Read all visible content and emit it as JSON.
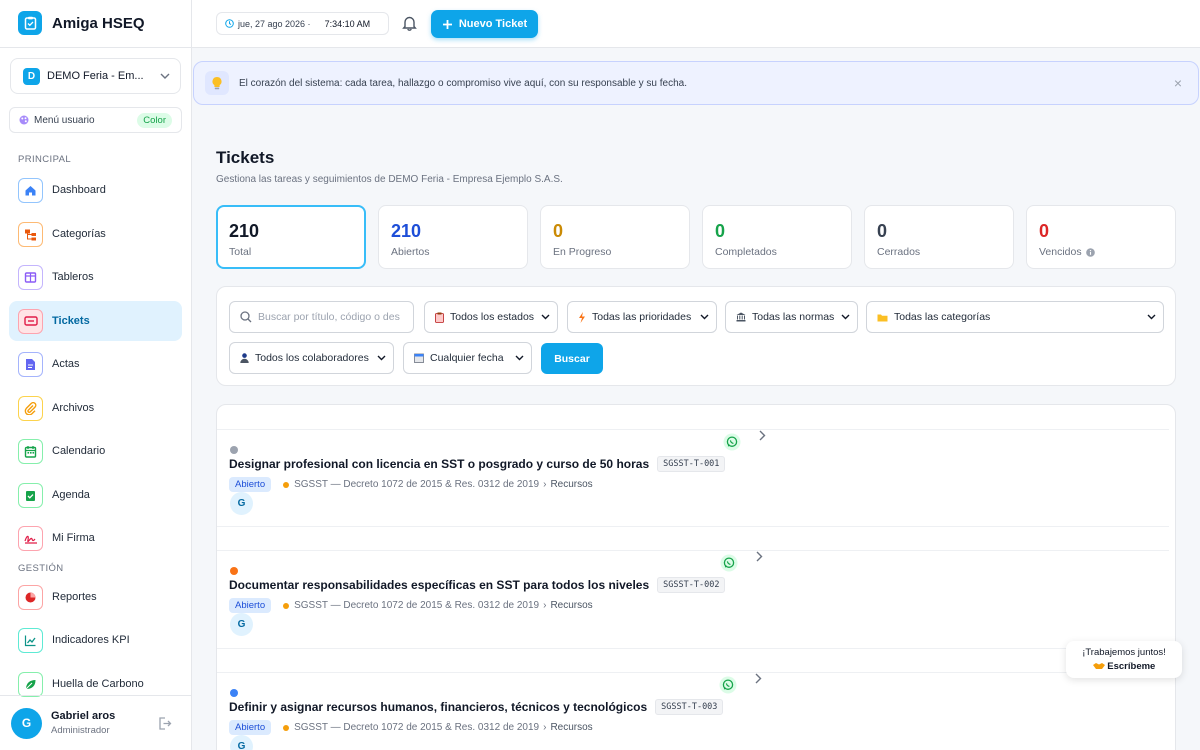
{
  "app": {
    "name": "Amiga HSEQ"
  },
  "org": {
    "badge": "D",
    "name": "DEMO Feria - Em..."
  },
  "user_menu": {
    "label": "Menú usuario",
    "badge": "Color"
  },
  "sections": {
    "principal": "PRINCIPAL",
    "gestion": "GESTIÓN"
  },
  "nav": [
    {
      "label": "Dashboard",
      "icon": "home-icon",
      "color": "#3b82f6"
    },
    {
      "label": "Categorías",
      "icon": "hierarchy-icon",
      "color": "#ea580c"
    },
    {
      "label": "Tableros",
      "icon": "board-icon",
      "color": "#8b5cf6"
    },
    {
      "label": "Tickets",
      "icon": "ticket-icon",
      "color": "#e11d48"
    },
    {
      "label": "Actas",
      "icon": "document-icon",
      "color": "#6366f1"
    },
    {
      "label": "Archivos",
      "icon": "paperclip-icon",
      "color": "#f59e0b"
    },
    {
      "label": "Calendario",
      "icon": "calendar-icon",
      "color": "#16a34a"
    },
    {
      "label": "Agenda",
      "icon": "checklist-icon",
      "color": "#16a34a"
    },
    {
      "label": "Mi Firma",
      "icon": "signature-icon",
      "color": "#e11d48"
    },
    {
      "label": "Reportes",
      "icon": "pie-chart-icon",
      "color": "#dc2626"
    },
    {
      "label": "Indicadores KPI",
      "icon": "line-chart-icon",
      "color": "#0d9488"
    },
    {
      "label": "Huella de Carbono",
      "icon": "leaf-icon",
      "color": "#16a34a"
    }
  ],
  "user": {
    "initial": "G",
    "name": "Gabriel aros",
    "role": "Administrador"
  },
  "topbar": {
    "date": "jue, 27 ago 2026 ·",
    "time": "7:34:10 AM",
    "new_ticket": "Nuevo Ticket"
  },
  "banner": {
    "text": "El corazón del sistema: cada tarea, hallazgo o compromiso vive aquí, con su responsable y su fecha.",
    "close": "×"
  },
  "header": {
    "title": "Tickets",
    "subtitle": "Gestiona las tareas y seguimientos de DEMO Feria - Empresa Ejemplo S.A.S."
  },
  "stats": [
    {
      "value": "210",
      "label": "Total",
      "color": "#111827"
    },
    {
      "value": "210",
      "label": "Abiertos",
      "color": "#1d4ed8"
    },
    {
      "value": "0",
      "label": "En Progreso",
      "color": "#ca8a04"
    },
    {
      "value": "0",
      "label": "Completados",
      "color": "#16a34a"
    },
    {
      "value": "0",
      "label": "Cerrados",
      "color": "#374151"
    },
    {
      "value": "0",
      "label": "Vencidos",
      "color": "#dc2626"
    }
  ],
  "filters": {
    "search_placeholder": "Buscar por título, código o des",
    "estado": "Todos los estados",
    "prioridad": "Todas las prioridades",
    "norma": "Todas las normas",
    "categoria": "Todas las categorías",
    "colaborador": "Todos los colaboradores",
    "fecha": "Cualquier fecha",
    "buscar": "Buscar"
  },
  "tickets": [
    {
      "title": "Designar profesional con licencia en SST o posgrado y curso de 50 horas",
      "code": "SGSST-T-001",
      "status": "Abierto",
      "norma": "SGSST — Decreto 1072 de 2015 & Res. 0312 de 2019",
      "sep": "›",
      "category": "Recursos",
      "assignee": "G",
      "dot_color": "#9ca3af"
    },
    {
      "title": "Documentar responsabilidades específicas en SST para todos los niveles",
      "code": "SGSST-T-002",
      "status": "Abierto",
      "norma": "SGSST — Decreto 1072 de 2015 & Res. 0312 de 2019",
      "sep": "›",
      "category": "Recursos",
      "assignee": "G",
      "dot_color": "#f97316"
    },
    {
      "title": "Definir y asignar recursos humanos, financieros, técnicos y tecnológicos",
      "code": "SGSST-T-003",
      "status": "Abierto",
      "norma": "SGSST — Decreto 1072 de 2015 & Res. 0312 de 2019",
      "sep": "›",
      "category": "Recursos",
      "assignee": "G",
      "dot_color": "#3b82f6"
    }
  ],
  "floating": {
    "line1": "¡Trabajemos juntos!",
    "line2": "Escríbeme"
  }
}
